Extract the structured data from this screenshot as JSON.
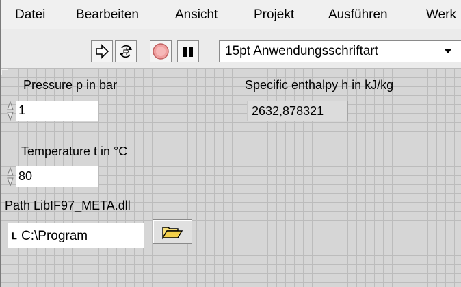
{
  "menu": {
    "items": [
      "Datei",
      "Bearbeiten",
      "Ansicht",
      "Projekt",
      "Ausführen",
      "Werk"
    ]
  },
  "toolbar": {
    "run_icon": "run-arrow-icon",
    "continuous_run_icon": "run-continuously-icon",
    "abort_icon": "abort-stop-icon",
    "pause_icon": "pause-icon",
    "font_select_value": "15pt Anwendungsschriftart"
  },
  "controls": {
    "pressure": {
      "label": "Pressure p in bar",
      "value": "1"
    },
    "temperature": {
      "label": "Temperature t in °C",
      "value": "80"
    },
    "path": {
      "label": "Path LibIF97_META.dll",
      "value": "C:\\Program",
      "browse_icon": "folder-open-icon"
    }
  },
  "indicators": {
    "enthalpy": {
      "label": "Specific enthalpy h in kJ/kg",
      "value": "2632,878321"
    }
  },
  "colors": {
    "grid_background": "#d6d6d6",
    "grid_line": "#bcbcbc",
    "folder_yellow": "#f3d04a"
  }
}
